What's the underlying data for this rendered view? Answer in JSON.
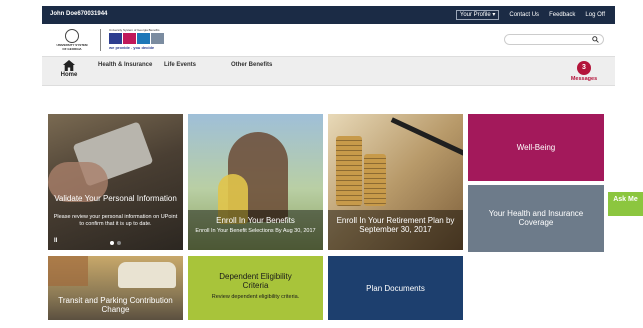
{
  "topbar": {
    "user": "John Doe670031944",
    "profile_label": "Your Profile",
    "links": [
      "Contact Us",
      "Feedback",
      "Log Off"
    ]
  },
  "header": {
    "seal_text": "UNIVERSITY SYSTEM OF GEORGIA",
    "brand_top": "University System of Georgia Benefits",
    "brand_tagline": "we provide . you decide",
    "search_placeholder": ""
  },
  "nav": {
    "home": "Home",
    "items": [
      "Health & Insurance",
      "Life Events",
      "Other Benefits"
    ],
    "messages_count": "3",
    "messages_label": "Messages"
  },
  "tiles": {
    "validate": {
      "title": "Validate Your Personal Information",
      "sub": "Please review your personal information on UPoint to confirm that it is up to date.",
      "pause": "II"
    },
    "enroll_benefits": {
      "title": "Enroll In Your Benefits",
      "sub": "Enroll In Your Benefit Selections By Aug 30, 2017"
    },
    "enroll_retirement": {
      "title": "Enroll In Your Retirement Plan by September 30, 2017"
    },
    "wellbeing": {
      "title": "Well-Being"
    },
    "health_coverage": {
      "title": "Your Health and Insurance Coverage"
    },
    "transit": {
      "title": "Transit and Parking Contribution Change"
    },
    "dependent": {
      "title": "Dependent Eligibility Criteria",
      "sub": "Review dependent eligibility criteria."
    },
    "plan_docs": {
      "title": "Plan Documents"
    }
  },
  "askme": "Ask Me",
  "colors": {
    "topbar": "#1b2b45",
    "wellbeing": "#a3195b",
    "health": "#6d7b8a",
    "dependent": "#a8c43a",
    "plan_docs": "#1d3f6e",
    "askme": "#8cc63f",
    "messages": "#b3143a"
  }
}
